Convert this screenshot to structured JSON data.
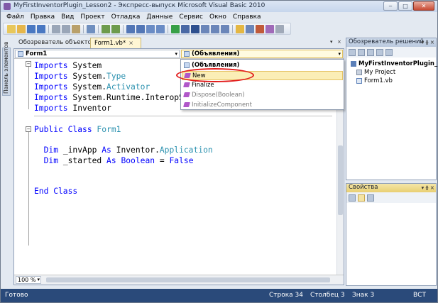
{
  "window": {
    "title": "MyFirstInventorPlugin_Lesson2 - Экспресс-выпуск Microsoft Visual Basic 2010",
    "minimize": "‒",
    "maximize": "□",
    "close": "✕"
  },
  "menu": [
    "Файл",
    "Правка",
    "Вид",
    "Проект",
    "Отладка",
    "Данные",
    "Сервис",
    "Окно",
    "Справка"
  ],
  "toolbar_icons": [
    "new-project-icon",
    "open-icon",
    "save-icon",
    "save-all-icon",
    "cut-icon",
    "copy-icon",
    "paste-icon",
    "find-icon",
    "comment-icon",
    "uncomment-icon",
    "undo-icon",
    "redo-icon",
    "navigate-back-icon",
    "navigate-forward-icon",
    "start-debug-icon",
    "pause-icon",
    "stop-icon",
    "step-into-icon",
    "step-over-icon",
    "step-out-icon",
    "solution-explorer-icon",
    "properties-icon",
    "object-browser-icon",
    "toolbox-icon",
    "extension-icon"
  ],
  "toolbar_colors": [
    "#e8c75a",
    "#e6b64a",
    "#4a78c2",
    "#4a78c2",
    "#9aa6b8",
    "#9aa6b8",
    "#b9a06a",
    "#6f8fbf",
    "#6d9b4c",
    "#6d9b4c",
    "#5276b6",
    "#5276b6",
    "#6a8cc5",
    "#6a8cc5",
    "#37a047",
    "#4a69a5",
    "#2d4f8e",
    "#6b86b9",
    "#6b86b9",
    "#6b86b9",
    "#e4b743",
    "#6b86b9",
    "#c05a3a",
    "#a06ab8",
    "#a0a9b8"
  ],
  "sidebar": {
    "toolbox_label": "Панель элементов"
  },
  "tabs": {
    "object_browser": "Обозреватель объектов",
    "form_file": "Form1.vb*",
    "close_glyph": "×",
    "dropdown_glyph": "▾",
    "close_all_glyph": "×"
  },
  "editor": {
    "class_combo": "Form1",
    "member_combo": "(Объявления)",
    "lines": [
      {
        "kind": "imports",
        "kw": "Imports ",
        "plain": "System",
        "type": ""
      },
      {
        "kind": "imports",
        "kw": "Imports ",
        "plain": "System.",
        "type": "Type"
      },
      {
        "kind": "imports",
        "kw": "Imports ",
        "plain": "System.",
        "type": "Activator"
      },
      {
        "kind": "imports",
        "kw": "Imports ",
        "plain": "System.Runtime.InteropSe",
        "type": ""
      },
      {
        "kind": "imports",
        "kw": "Imports ",
        "plain": "Inventor",
        "type": ""
      }
    ],
    "class_decl": {
      "kw": "Public Class ",
      "type": "Form1"
    },
    "dim1": {
      "kw1": "Dim ",
      "plain1": "_invApp ",
      "kw2": "As ",
      "plain2": "Inventor.",
      "type": "Application"
    },
    "dim2": {
      "kw1": "Dim ",
      "plain1": "_started ",
      "kw2": "As Boolean ",
      "plain2": "= ",
      "kw3": "False"
    },
    "end_class": "End Class",
    "collapse_glyph": "−",
    "zoom": "100 %"
  },
  "member_dropdown": {
    "items": [
      {
        "label": "(Объявления)",
        "style": "bold",
        "icon": "declarations-icon"
      },
      {
        "label": "New",
        "style": "hover",
        "icon": "method-icon"
      },
      {
        "label": "Finalize",
        "style": "normal",
        "icon": "method-icon"
      },
      {
        "label": "Dispose(Boolean)",
        "style": "gray",
        "icon": "method-icon"
      },
      {
        "label": "InitializeComponent",
        "style": "gray",
        "icon": "method-icon"
      }
    ],
    "highlight_color": "#e21d1d"
  },
  "solution_explorer": {
    "title": "Обозреватель решений",
    "pin_glyph": "▾ ᚕ ×",
    "project": "MyFirstInventorPlugin_Lesson",
    "items": [
      "My Project",
      "Form1.vb"
    ]
  },
  "properties": {
    "title": "Свойства",
    "pin_glyph": "▾ ᚕ ×"
  },
  "statusbar": {
    "ready": "Готово",
    "line": "Строка 34",
    "column": "Столбец 3",
    "char": "Знак 3",
    "mode": "ВСТ"
  },
  "colors": {
    "keyword": "#0000ff",
    "type": "#2b91af",
    "statusbar": "#2a4a7a"
  }
}
